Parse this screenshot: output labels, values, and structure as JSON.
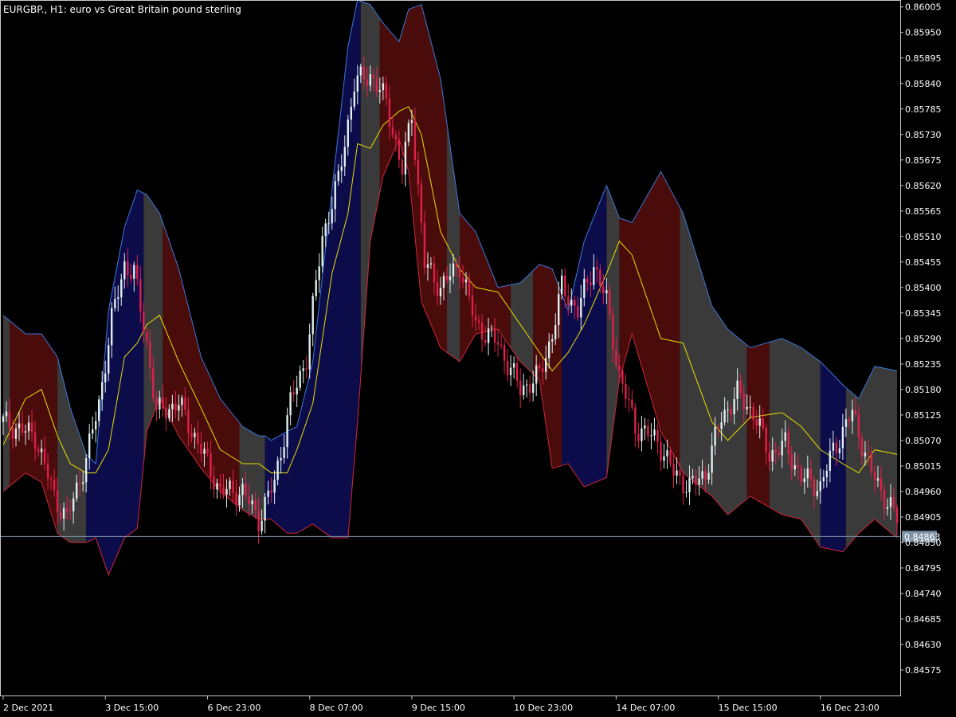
{
  "window": {
    "title": "EURGBP., H1:  euro vs Great Britain pound sterling"
  },
  "colors": {
    "background": "#000000",
    "frame": "#c8c8c8",
    "band_up": "#0c0c4a",
    "band_down": "#4a0b0b",
    "band_flat": "#3a3a3a",
    "upper_line": "#3c78d8",
    "lower_line": "#d0263a",
    "middle_line": "#e8e000",
    "candle_bull": "#dfeeee",
    "candle_bear": "#e0204a",
    "price_line": "#7e93a6",
    "price_label_bg": "#7e93a6"
  },
  "chart_data": {
    "type": "candlestick",
    "symbol": "EURGBP.",
    "timeframe": "H1",
    "description": "euro vs Great Britain pound sterling",
    "ylim": [
      0.8452,
      0.8602
    ],
    "y_ticks": [
      "0.86005",
      "0.85950",
      "0.85895",
      "0.85840",
      "0.85785",
      "0.85730",
      "0.85675",
      "0.85620",
      "0.85565",
      "0.85510",
      "0.85455",
      "0.85400",
      "0.85345",
      "0.85290",
      "0.85235",
      "0.85180",
      "0.85125",
      "0.85070",
      "0.85015",
      "0.84960",
      "0.84905",
      "0.84850",
      "0.84795",
      "0.84740",
      "0.84685",
      "0.84630",
      "0.84575"
    ],
    "x_ticks": [
      "2 Dec 2021",
      "3 Dec 15:00",
      "6 Dec 23:00",
      "8 Dec 07:00",
      "9 Dec 15:00",
      "10 Dec 23:00",
      "14 Dec 07:00",
      "15 Dec 15:00",
      "16 Dec 23:00"
    ],
    "x_tick_bars": [
      0,
      32,
      64,
      96,
      128,
      160,
      192,
      224,
      256
    ],
    "bar_count": 281,
    "current_price": "0.84863",
    "band_anchors": [
      [
        0,
        0.8534,
        0.8506,
        0.8496
      ],
      [
        7,
        0.853,
        0.8516,
        0.85
      ],
      [
        12,
        0.853,
        0.8518,
        0.8498
      ],
      [
        17,
        0.8525,
        0.8508,
        0.8487
      ],
      [
        21,
        0.8514,
        0.8502,
        0.8485
      ],
      [
        26,
        0.8504,
        0.85,
        0.8485
      ],
      [
        29,
        0.8502,
        0.85,
        0.8486
      ],
      [
        33,
        0.8535,
        0.8505,
        0.8478
      ],
      [
        38,
        0.8553,
        0.8525,
        0.8486
      ],
      [
        42,
        0.8561,
        0.8528,
        0.8488
      ],
      [
        45,
        0.856,
        0.8532,
        0.8509
      ],
      [
        49,
        0.8556,
        0.8534,
        0.8516
      ],
      [
        55,
        0.8544,
        0.8524,
        0.8508
      ],
      [
        62,
        0.8525,
        0.8514,
        0.8501
      ],
      [
        68,
        0.8516,
        0.8505,
        0.8496
      ],
      [
        75,
        0.851,
        0.8502,
        0.8492
      ],
      [
        80,
        0.8508,
        0.8502,
        0.849
      ],
      [
        82,
        0.8508,
        0.8501,
        0.849
      ],
      [
        84,
        0.8507,
        0.85,
        0.849
      ],
      [
        89,
        0.8509,
        0.85,
        0.8487
      ],
      [
        92,
        0.851,
        0.8505,
        0.8487
      ],
      [
        97,
        0.8524,
        0.8515,
        0.8489
      ],
      [
        103,
        0.8561,
        0.8543,
        0.8486
      ],
      [
        108,
        0.8592,
        0.8556,
        0.8486
      ],
      [
        111,
        0.8602,
        0.8571,
        0.8511
      ],
      [
        115,
        0.8601,
        0.857,
        0.855
      ],
      [
        119,
        0.8597,
        0.8575,
        0.8564
      ],
      [
        124,
        0.8593,
        0.8578,
        0.8572
      ],
      [
        127,
        0.86,
        0.8579,
        0.8565
      ],
      [
        131,
        0.8601,
        0.8573,
        0.8537
      ],
      [
        137,
        0.8585,
        0.8552,
        0.8527
      ],
      [
        143,
        0.8556,
        0.8544,
        0.8524
      ],
      [
        148,
        0.8552,
        0.854,
        0.853
      ],
      [
        155,
        0.854,
        0.8539,
        0.8531
      ],
      [
        162,
        0.8541,
        0.8532,
        0.8524
      ],
      [
        168,
        0.8545,
        0.8526,
        0.852
      ],
      [
        172,
        0.8544,
        0.8522,
        0.8501
      ],
      [
        177,
        0.8535,
        0.8526,
        0.8502
      ],
      [
        182,
        0.855,
        0.8532,
        0.8497
      ],
      [
        189,
        0.8562,
        0.8543,
        0.8499
      ],
      [
        193,
        0.8555,
        0.855,
        0.852
      ],
      [
        197,
        0.8554,
        0.8547,
        0.853
      ],
      [
        206,
        0.8565,
        0.8529,
        0.8509
      ],
      [
        213,
        0.8556,
        0.8528,
        0.85
      ],
      [
        222,
        0.8536,
        0.8511,
        0.8495
      ],
      [
        227,
        0.8531,
        0.8507,
        0.8491
      ],
      [
        234,
        0.8527,
        0.8512,
        0.8495
      ],
      [
        244,
        0.8529,
        0.8513,
        0.8491
      ],
      [
        250,
        0.8527,
        0.851,
        0.849
      ],
      [
        256,
        0.8524,
        0.8505,
        0.8484
      ],
      [
        263,
        0.8519,
        0.8502,
        0.8483
      ],
      [
        268,
        0.8516,
        0.85,
        0.8487
      ],
      [
        273,
        0.8523,
        0.8505,
        0.849
      ],
      [
        280,
        0.8522,
        0.8504,
        0.8486
      ]
    ],
    "regimes": [
      [
        0,
        2,
        "flat"
      ],
      [
        2,
        17,
        "down"
      ],
      [
        17,
        26,
        "flat"
      ],
      [
        26,
        44,
        "up"
      ],
      [
        44,
        50,
        "flat"
      ],
      [
        50,
        74,
        "down"
      ],
      [
        74,
        82,
        "flat"
      ],
      [
        82,
        112,
        "up"
      ],
      [
        112,
        118,
        "flat"
      ],
      [
        118,
        139,
        "down"
      ],
      [
        139,
        143,
        "flat"
      ],
      [
        143,
        159,
        "down"
      ],
      [
        159,
        166,
        "flat"
      ],
      [
        166,
        175,
        "down"
      ],
      [
        175,
        189,
        "up"
      ],
      [
        189,
        193,
        "flat"
      ],
      [
        193,
        212,
        "down"
      ],
      [
        212,
        233,
        "flat"
      ],
      [
        233,
        240,
        "down"
      ],
      [
        240,
        256,
        "flat"
      ],
      [
        256,
        264,
        "up"
      ],
      [
        264,
        281,
        "flat"
      ]
    ],
    "close_anchors": [
      [
        0,
        0.8511
      ],
      [
        10,
        0.8508
      ],
      [
        16,
        0.8495
      ],
      [
        20,
        0.849
      ],
      [
        26,
        0.8503
      ],
      [
        30,
        0.8515
      ],
      [
        34,
        0.8533
      ],
      [
        38,
        0.8545
      ],
      [
        41,
        0.8543
      ],
      [
        45,
        0.8528
      ],
      [
        48,
        0.8513
      ],
      [
        55,
        0.8515
      ],
      [
        62,
        0.8505
      ],
      [
        68,
        0.8496
      ],
      [
        75,
        0.8496
      ],
      [
        80,
        0.849
      ],
      [
        85,
        0.8498
      ],
      [
        90,
        0.8515
      ],
      [
        95,
        0.8525
      ],
      [
        100,
        0.8551
      ],
      [
        105,
        0.8563
      ],
      [
        110,
        0.8584
      ],
      [
        115,
        0.8586
      ],
      [
        120,
        0.858
      ],
      [
        125,
        0.8565
      ],
      [
        128,
        0.8578
      ],
      [
        132,
        0.8545
      ],
      [
        137,
        0.854
      ],
      [
        143,
        0.8545
      ],
      [
        148,
        0.8532
      ],
      [
        155,
        0.8528
      ],
      [
        162,
        0.8518
      ],
      [
        168,
        0.8521
      ],
      [
        172,
        0.853
      ],
      [
        175,
        0.854
      ],
      [
        180,
        0.8535
      ],
      [
        185,
        0.8545
      ],
      [
        189,
        0.8537
      ],
      [
        193,
        0.8521
      ],
      [
        198,
        0.851
      ],
      [
        205,
        0.8507
      ],
      [
        210,
        0.85
      ],
      [
        215,
        0.8497
      ],
      [
        220,
        0.85
      ],
      [
        225,
        0.8512
      ],
      [
        230,
        0.8517
      ],
      [
        235,
        0.8513
      ],
      [
        240,
        0.8504
      ],
      [
        245,
        0.8506
      ],
      [
        250,
        0.8499
      ],
      [
        256,
        0.8497
      ],
      [
        260,
        0.8505
      ],
      [
        266,
        0.8513
      ],
      [
        272,
        0.85
      ],
      [
        276,
        0.8495
      ],
      [
        280,
        0.849
      ]
    ]
  }
}
